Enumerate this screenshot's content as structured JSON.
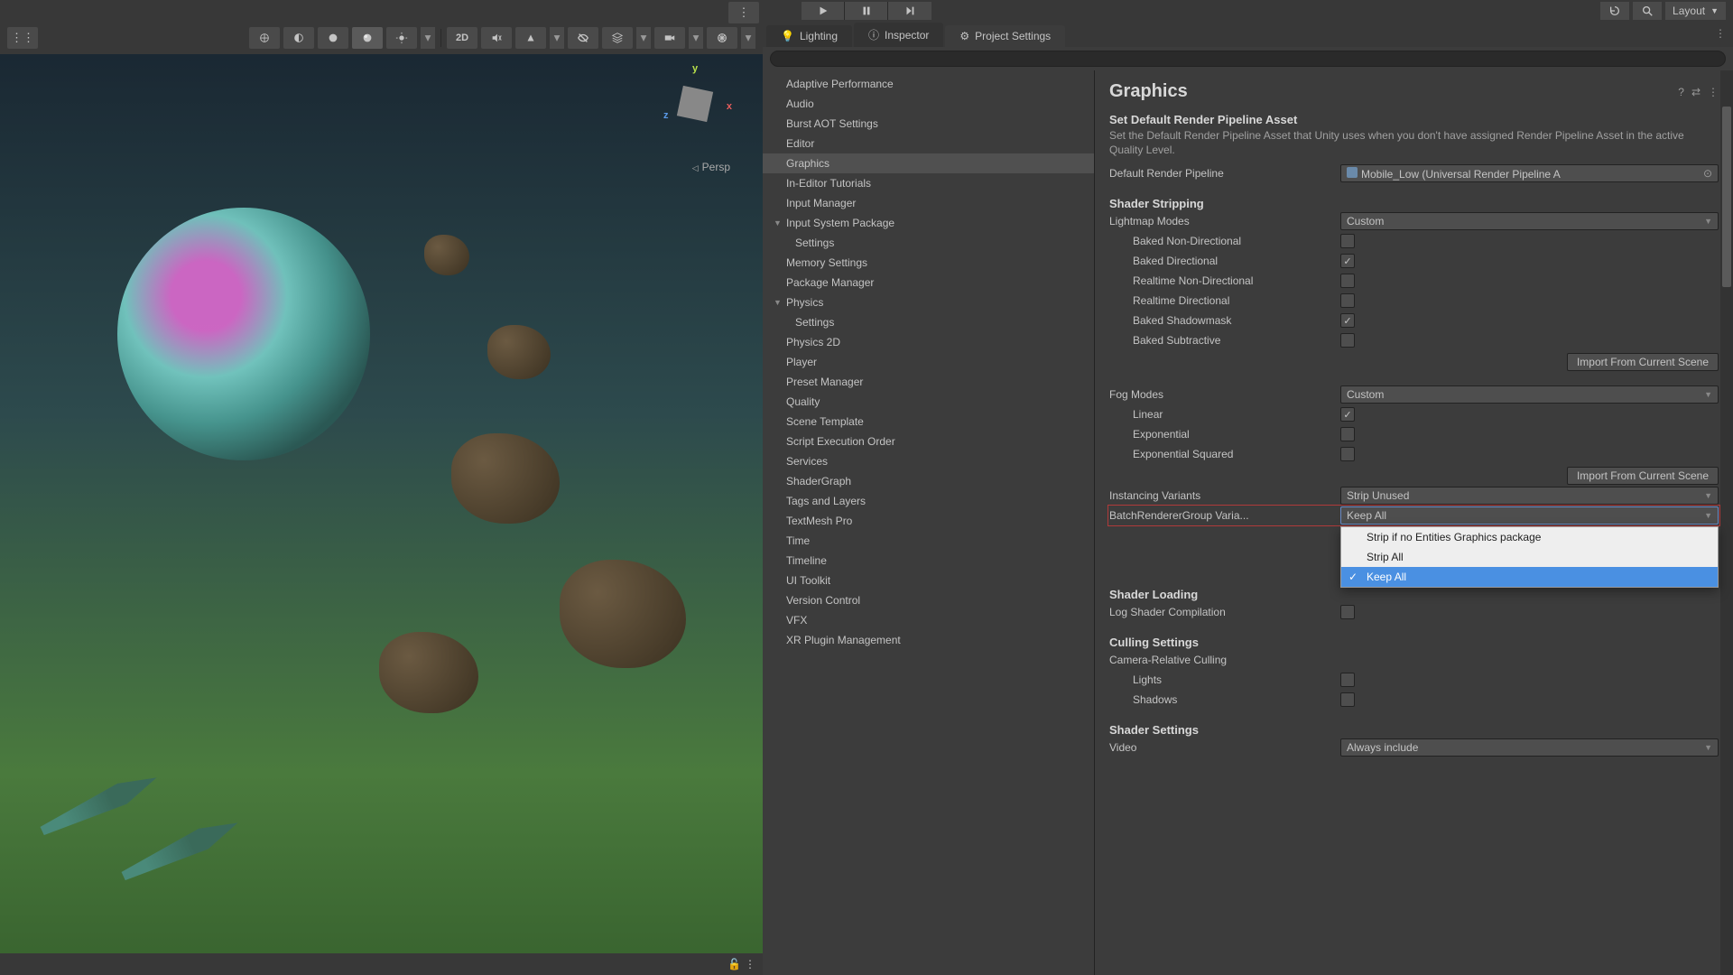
{
  "topbar": {
    "layout_label": "Layout"
  },
  "tabs": {
    "lighting": "Lighting",
    "inspector": "Inspector",
    "project_settings": "Project Settings"
  },
  "scene": {
    "persp": "Persp",
    "mode_2d": "2D",
    "axis_x": "x",
    "axis_y": "y",
    "axis_z": "z"
  },
  "nav": {
    "adaptive_performance": "Adaptive Performance",
    "audio": "Audio",
    "burst_aot": "Burst AOT Settings",
    "editor": "Editor",
    "graphics": "Graphics",
    "in_editor_tutorials": "In-Editor Tutorials",
    "input_manager": "Input Manager",
    "input_system_package": "Input System Package",
    "settings_child": "Settings",
    "memory_settings": "Memory Settings",
    "package_manager": "Package Manager",
    "physics": "Physics",
    "physics_2d": "Physics 2D",
    "player": "Player",
    "preset_manager": "Preset Manager",
    "quality": "Quality",
    "scene_template": "Scene Template",
    "script_execution_order": "Script Execution Order",
    "services": "Services",
    "shadergraph": "ShaderGraph",
    "tags_and_layers": "Tags and Layers",
    "textmesh_pro": "TextMesh Pro",
    "time": "Time",
    "timeline": "Timeline",
    "ui_toolkit": "UI Toolkit",
    "version_control": "Version Control",
    "vfx": "VFX",
    "xr_plugin": "XR Plugin Management"
  },
  "graphics": {
    "title": "Graphics",
    "default_pipeline_heading": "Set Default Render Pipeline Asset",
    "default_pipeline_desc": "Set the Default Render Pipeline Asset that Unity uses when you don't have assigned Render Pipeline Asset in the active Quality Level.",
    "default_pipeline_label": "Default Render Pipeline",
    "default_pipeline_value": "Mobile_Low (Universal Render Pipeline A",
    "shader_stripping": "Shader Stripping",
    "lightmap_modes": "Lightmap Modes",
    "lightmap_modes_value": "Custom",
    "baked_non_directional": "Baked Non-Directional",
    "baked_directional": "Baked Directional",
    "realtime_non_directional": "Realtime Non-Directional",
    "realtime_directional": "Realtime Directional",
    "baked_shadowmask": "Baked Shadowmask",
    "baked_subtractive": "Baked Subtractive",
    "import_from_scene": "Import From Current Scene",
    "fog_modes": "Fog Modes",
    "fog_modes_value": "Custom",
    "linear": "Linear",
    "exponential": "Exponential",
    "exponential_squared": "Exponential Squared",
    "instancing_variants": "Instancing Variants",
    "instancing_variants_value": "Strip Unused",
    "batch_renderer_group": "BatchRendererGroup Varia...",
    "batch_renderer_group_value": "Keep All",
    "dropdown_options": {
      "strip_if_none": "Strip if no Entities Graphics package",
      "strip_all": "Strip All",
      "keep_all": "Keep All"
    },
    "shader_loading": "Shader Loading",
    "log_shader_compilation": "Log Shader Compilation",
    "culling_settings": "Culling Settings",
    "camera_relative_culling": "Camera-Relative Culling",
    "lights": "Lights",
    "shadows": "Shadows",
    "shader_settings": "Shader Settings",
    "video": "Video",
    "video_value": "Always include"
  }
}
